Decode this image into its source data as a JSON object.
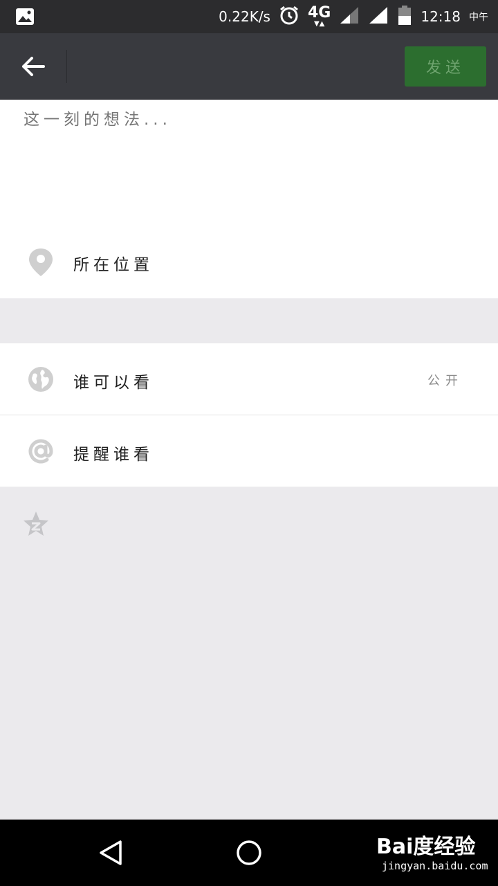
{
  "status_bar": {
    "net_speed": "0.22K/s",
    "network": "4G",
    "time": "12:18",
    "period": "中午",
    "icons": [
      "gallery-icon",
      "alarm-icon",
      "data-arrows-icon",
      "signal-icon",
      "signal-icon",
      "battery-icon"
    ]
  },
  "top_bar": {
    "back_icon": "arrow-left-icon",
    "send_label": "发送",
    "send_color": "#2c6e2f"
  },
  "compose": {
    "placeholder": "这一刻的想法...",
    "location_label": "所在位置",
    "location_icon": "map-pin-icon"
  },
  "settings": [
    {
      "icon": "globe-icon",
      "label": "谁可以看",
      "value": "公开"
    },
    {
      "icon": "at-icon",
      "label": "提醒谁看",
      "value": ""
    }
  ],
  "extra_icon": "qzone-star-icon",
  "nav_bar": {
    "icons": [
      "back-triangle-icon",
      "home-circle-icon"
    ]
  },
  "watermark": {
    "logo_text": "Bai度经验",
    "url": "jingyan.baidu.com"
  }
}
